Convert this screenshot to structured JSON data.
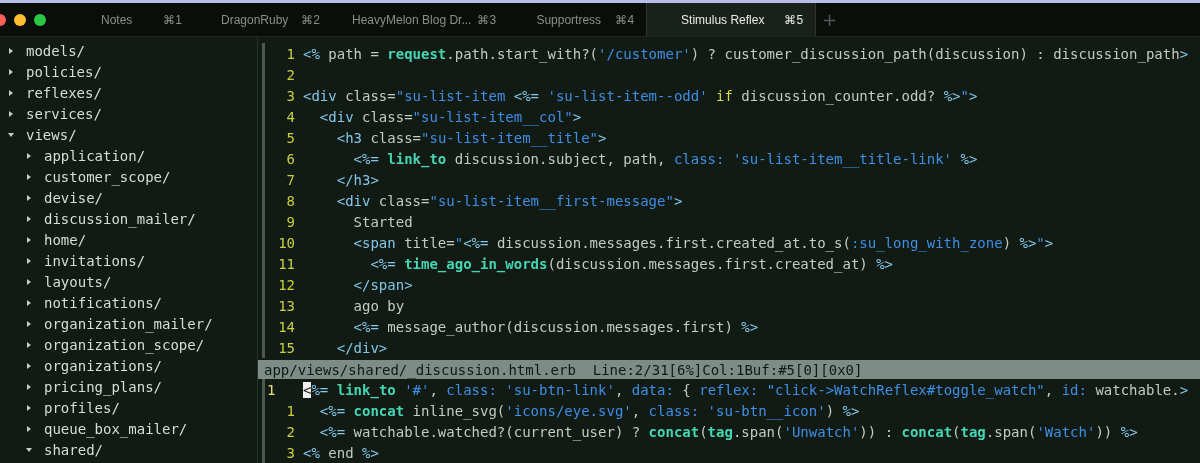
{
  "tabs": [
    {
      "label": "Notes",
      "shortcut": "⌘1",
      "selected": false
    },
    {
      "label": "DragonRuby",
      "shortcut": "⌘2",
      "selected": false
    },
    {
      "label": "HeavyMelon Blog Dr...",
      "shortcut": "⌘3",
      "selected": false
    },
    {
      "label": "Supportress",
      "shortcut": "⌘4",
      "selected": false
    },
    {
      "label": "Stimulus Reflex",
      "shortcut": "⌘5",
      "selected": true
    }
  ],
  "new_tab": "+",
  "tree": [
    {
      "name": "models/",
      "expanded": false
    },
    {
      "name": "policies/",
      "expanded": false
    },
    {
      "name": "reflexes/",
      "expanded": false
    },
    {
      "name": "services/",
      "expanded": false
    },
    {
      "name": "views/",
      "expanded": true,
      "children": [
        {
          "name": "application/",
          "expanded": false
        },
        {
          "name": "customer_scope/",
          "expanded": false
        },
        {
          "name": "devise/",
          "expanded": false
        },
        {
          "name": "discussion_mailer/",
          "expanded": false
        },
        {
          "name": "home/",
          "expanded": false
        },
        {
          "name": "invitations/",
          "expanded": false
        },
        {
          "name": "layouts/",
          "expanded": false
        },
        {
          "name": "notifications/",
          "expanded": false
        },
        {
          "name": "organization_mailer/",
          "expanded": false
        },
        {
          "name": "organization_scope/",
          "expanded": false
        },
        {
          "name": "organizations/",
          "expanded": false
        },
        {
          "name": "pricing_plans/",
          "expanded": false
        },
        {
          "name": "profiles/",
          "expanded": false
        },
        {
          "name": "queue_box_mailer/",
          "expanded": false
        },
        {
          "name": "shared/",
          "expanded": true
        }
      ]
    }
  ],
  "top_pane": {
    "lines": [
      {
        "number": "1",
        "current": false,
        "tokens": [
          {
            "kind": "tag",
            "text": "<%"
          },
          {
            "kind": "text",
            "text": " path = "
          },
          {
            "kind": "method",
            "text": "request"
          },
          {
            "kind": "text",
            "text": ".path.start_with?("
          },
          {
            "kind": "string",
            "text": "'/customer'"
          },
          {
            "kind": "text",
            "text": ") ? customer_discussion_path(discussion) : discussion_path"
          },
          {
            "kind": "tag",
            "text": ">"
          }
        ]
      },
      {
        "number": "2",
        "current": false
      },
      {
        "number": "3",
        "current": false,
        "tokens": [
          {
            "kind": "tag",
            "text": "<div"
          },
          {
            "kind": "text",
            "text": " class="
          },
          {
            "kind": "string",
            "text": "\"su-list-item "
          },
          {
            "kind": "tag",
            "text": "<%= "
          },
          {
            "kind": "string",
            "text": "'su-list-item--odd' "
          },
          {
            "kind": "keyword",
            "text": "if"
          },
          {
            "kind": "text",
            "text": " discussion_counter.odd? "
          },
          {
            "kind": "tag",
            "text": "%>"
          },
          {
            "kind": "string",
            "text": "\""
          },
          {
            "kind": "tag",
            "text": ">"
          }
        ]
      },
      {
        "number": "4",
        "current": false,
        "tokens": [
          {
            "kind": "tag",
            "text": "  <div"
          },
          {
            "kind": "text",
            "text": " class="
          },
          {
            "kind": "string",
            "text": "\"su-list-item__col\""
          },
          {
            "kind": "tag",
            "text": ">"
          }
        ]
      },
      {
        "number": "5",
        "current": false,
        "tokens": [
          {
            "kind": "tag",
            "text": "    <h3"
          },
          {
            "kind": "text",
            "text": " class="
          },
          {
            "kind": "string",
            "text": "\"su-list-item__title\""
          },
          {
            "kind": "tag",
            "text": ">"
          }
        ]
      },
      {
        "number": "6",
        "current": false,
        "tokens": [
          {
            "kind": "tag",
            "text": "      <%= "
          },
          {
            "kind": "method",
            "text": "link_to"
          },
          {
            "kind": "text",
            "text": " discussion.subject, path, "
          },
          {
            "kind": "string",
            "text": "class: 'su-list-item__title-link' "
          },
          {
            "kind": "tag",
            "text": "%>"
          }
        ]
      },
      {
        "number": "7",
        "current": false,
        "tokens": [
          {
            "kind": "tag",
            "text": "    </h3>"
          }
        ]
      },
      {
        "number": "8",
        "current": false,
        "tokens": [
          {
            "kind": "tag",
            "text": "    <div"
          },
          {
            "kind": "text",
            "text": " class="
          },
          {
            "kind": "string",
            "text": "\"su-list-item__first-message\""
          },
          {
            "kind": "tag",
            "text": ">"
          }
        ]
      },
      {
        "number": "9",
        "current": false,
        "tokens": [
          {
            "kind": "text",
            "text": "      Started"
          }
        ]
      },
      {
        "number": "10",
        "current": false,
        "tokens": [
          {
            "kind": "tag",
            "text": "      <span"
          },
          {
            "kind": "text",
            "text": " title="
          },
          {
            "kind": "string",
            "text": "\""
          },
          {
            "kind": "tag",
            "text": "<%="
          },
          {
            "kind": "text",
            "text": " discussion.messages.first.created_at.to_s("
          },
          {
            "kind": "string",
            "text": ":su_long_with_zone"
          },
          {
            "kind": "text",
            "text": ") "
          },
          {
            "kind": "tag",
            "text": "%>"
          },
          {
            "kind": "string",
            "text": "\""
          },
          {
            "kind": "tag",
            "text": ">"
          }
        ]
      },
      {
        "number": "11",
        "current": false,
        "tokens": [
          {
            "kind": "tag",
            "text": "        <%= "
          },
          {
            "kind": "method",
            "text": "time_ago_in_words"
          },
          {
            "kind": "text",
            "text": "(discussion.messages.first.created_at) "
          },
          {
            "kind": "tag",
            "text": "%>"
          }
        ]
      },
      {
        "number": "12",
        "current": false,
        "tokens": [
          {
            "kind": "tag",
            "text": "      </span>"
          }
        ]
      },
      {
        "number": "13",
        "current": false,
        "tokens": [
          {
            "kind": "text",
            "text": "      ago by"
          }
        ]
      },
      {
        "number": "14",
        "current": false,
        "tokens": [
          {
            "kind": "tag",
            "text": "      <%="
          },
          {
            "kind": "text",
            "text": " message_author(discussion.messages.first) "
          },
          {
            "kind": "tag",
            "text": "%>"
          }
        ]
      },
      {
        "number": "15",
        "current": false,
        "tokens": [
          {
            "kind": "tag",
            "text": "    </div>"
          }
        ]
      }
    ]
  },
  "status_line": "app/views/shared/_discussion.html.erb  Line:2/31[6%]Col:1Buf:#5[0][0x0]",
  "bottom_pane": {
    "lines": [
      {
        "number": "1",
        "current": true,
        "tokens": [
          {
            "kind": "cursor",
            "text": "<"
          },
          {
            "kind": "tag",
            "text": "%= "
          },
          {
            "kind": "method",
            "text": "link_to"
          },
          {
            "kind": "string",
            "text": " '#'"
          },
          {
            "kind": "text",
            "text": ", "
          },
          {
            "kind": "string",
            "text": "class: 'su-btn-link'"
          },
          {
            "kind": "text",
            "text": ", "
          },
          {
            "kind": "string",
            "text": "data:"
          },
          {
            "kind": "text",
            "text": " { "
          },
          {
            "kind": "string",
            "text": "reflex: \"click->WatchReflex#toggle_watch\""
          },
          {
            "kind": "text",
            "text": ", "
          },
          {
            "kind": "string",
            "text": "id:"
          },
          {
            "kind": "text",
            "text": " watchable."
          },
          {
            "kind": "tag",
            "text": ">"
          }
        ]
      },
      {
        "number": "1",
        "current": false,
        "tokens": [
          {
            "kind": "tag",
            "text": "  <%= "
          },
          {
            "kind": "method",
            "text": "concat"
          },
          {
            "kind": "text",
            "text": " inline_svg("
          },
          {
            "kind": "string",
            "text": "'icons/eye.svg'"
          },
          {
            "kind": "text",
            "text": ", "
          },
          {
            "kind": "string",
            "text": "class: 'su-btn__icon'"
          },
          {
            "kind": "text",
            "text": ") "
          },
          {
            "kind": "tag",
            "text": "%>"
          }
        ]
      },
      {
        "number": "2",
        "current": false,
        "tokens": [
          {
            "kind": "tag",
            "text": "  <%="
          },
          {
            "kind": "text",
            "text": " watchable.watched?(current_user) ? "
          },
          {
            "kind": "method",
            "text": "concat"
          },
          {
            "kind": "text",
            "text": "("
          },
          {
            "kind": "method",
            "text": "tag"
          },
          {
            "kind": "text",
            "text": ".span("
          },
          {
            "kind": "string",
            "text": "'Unwatch'"
          },
          {
            "kind": "text",
            "text": ")) : "
          },
          {
            "kind": "method",
            "text": "concat"
          },
          {
            "kind": "text",
            "text": "("
          },
          {
            "kind": "method",
            "text": "tag"
          },
          {
            "kind": "text",
            "text": ".span("
          },
          {
            "kind": "string",
            "text": "'Watch'"
          },
          {
            "kind": "text",
            "text": ")) "
          },
          {
            "kind": "tag",
            "text": "%>"
          }
        ]
      },
      {
        "number": "3",
        "current": false,
        "tokens": [
          {
            "kind": "tag",
            "text": "<%"
          },
          {
            "kind": "text",
            "text": " end "
          },
          {
            "kind": "tag",
            "text": "%>"
          }
        ]
      }
    ]
  }
}
